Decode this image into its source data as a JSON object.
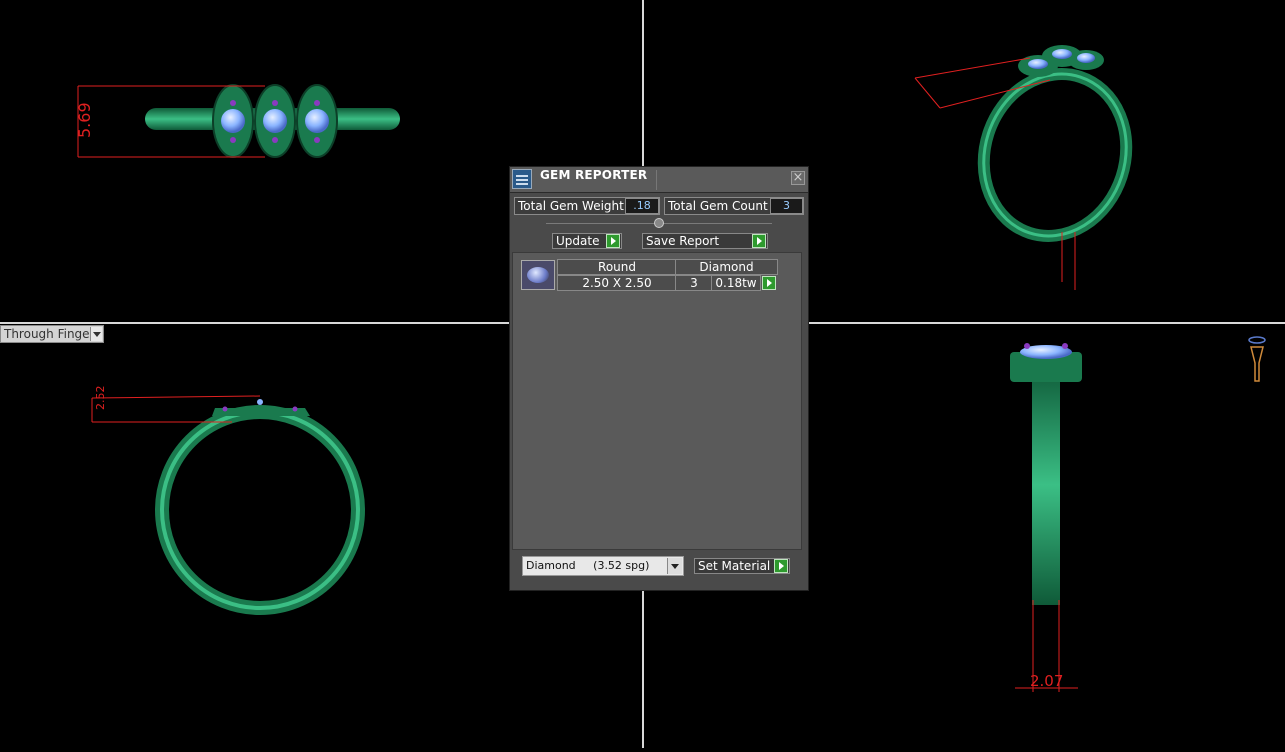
{
  "viewport": {
    "view_mode_label": "Through Finger",
    "dimensions": {
      "top_left_height": "5.69",
      "bottom_left_height": "2.52",
      "bottom_right_width": "2.07"
    }
  },
  "gem_reporter": {
    "title": "GEM REPORTER",
    "close_label": "×",
    "total_weight_label": "Total Gem Weight",
    "total_weight_value": ".18",
    "total_count_label": "Total Gem Count",
    "total_count_value": "3",
    "update_label": "Update",
    "save_report_label": "Save Report",
    "gems": [
      {
        "shape": "Round",
        "material": "Diamond",
        "size": "2.50 X 2.50",
        "count": "3",
        "weight": "0.18tw"
      }
    ],
    "material_select": "Diamond     (3.52 spg)",
    "set_material_label": "Set Material"
  },
  "colors": {
    "ring_green": "#1e8c5a",
    "dimension_red": "#e02020",
    "gem_blue": "#8ab4ff",
    "go_green": "#2e9a2e"
  }
}
